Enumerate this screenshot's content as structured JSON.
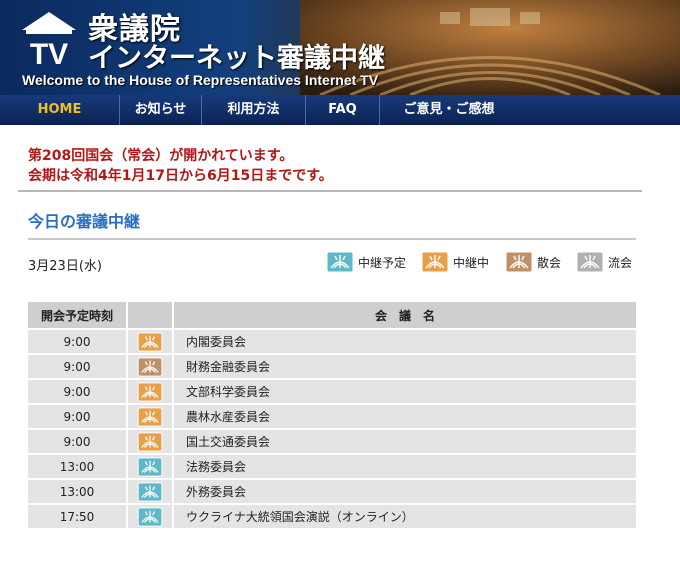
{
  "header": {
    "title_jp_1": "衆議院",
    "title_jp_2": "インターネット審議中継",
    "title_en": "Welcome to the House of Representatives Internet TV",
    "logo_text": "TV"
  },
  "nav": {
    "items": [
      {
        "label": "HOME"
      },
      {
        "label": "お知らせ"
      },
      {
        "label": "利用方法"
      },
      {
        "label": "FAQ"
      },
      {
        "label": "ご意見・ご感想"
      }
    ],
    "active_color": "#f0c020"
  },
  "notice": {
    "line1": "第208回国会（常会）が開かれています。",
    "line2": "会期は令和4年1月17日から6月15日までです。"
  },
  "section": {
    "title": "今日の審議中継",
    "date": "3月23日(水)"
  },
  "legend": {
    "items": [
      {
        "label": "中継予定",
        "status": "scheduled"
      },
      {
        "label": "中継中",
        "status": "live"
      },
      {
        "label": "散会",
        "status": "adjourned"
      },
      {
        "label": "流会",
        "status": "cancelled"
      }
    ]
  },
  "status_colors": {
    "scheduled": "#5fb8c8",
    "live": "#e8a048",
    "adjourned": "#c09068",
    "cancelled": "#b0b0b0"
  },
  "table": {
    "headers": {
      "time": "開会予定時刻",
      "status": "",
      "name": "会　議　名"
    },
    "rows": [
      {
        "time": "9:00",
        "status": "live",
        "name": "内閣委員会"
      },
      {
        "time": "9:00",
        "status": "adjourned",
        "name": "財務金融委員会"
      },
      {
        "time": "9:00",
        "status": "live",
        "name": "文部科学委員会"
      },
      {
        "time": "9:00",
        "status": "live",
        "name": "農林水産委員会"
      },
      {
        "time": "9:00",
        "status": "live",
        "name": "国土交通委員会"
      },
      {
        "time": "13:00",
        "status": "scheduled",
        "name": "法務委員会"
      },
      {
        "time": "13:00",
        "status": "scheduled",
        "name": "外務委員会"
      },
      {
        "time": "17:50",
        "status": "scheduled",
        "name": "ウクライナ大統領国会演説（オンライン）"
      }
    ]
  }
}
